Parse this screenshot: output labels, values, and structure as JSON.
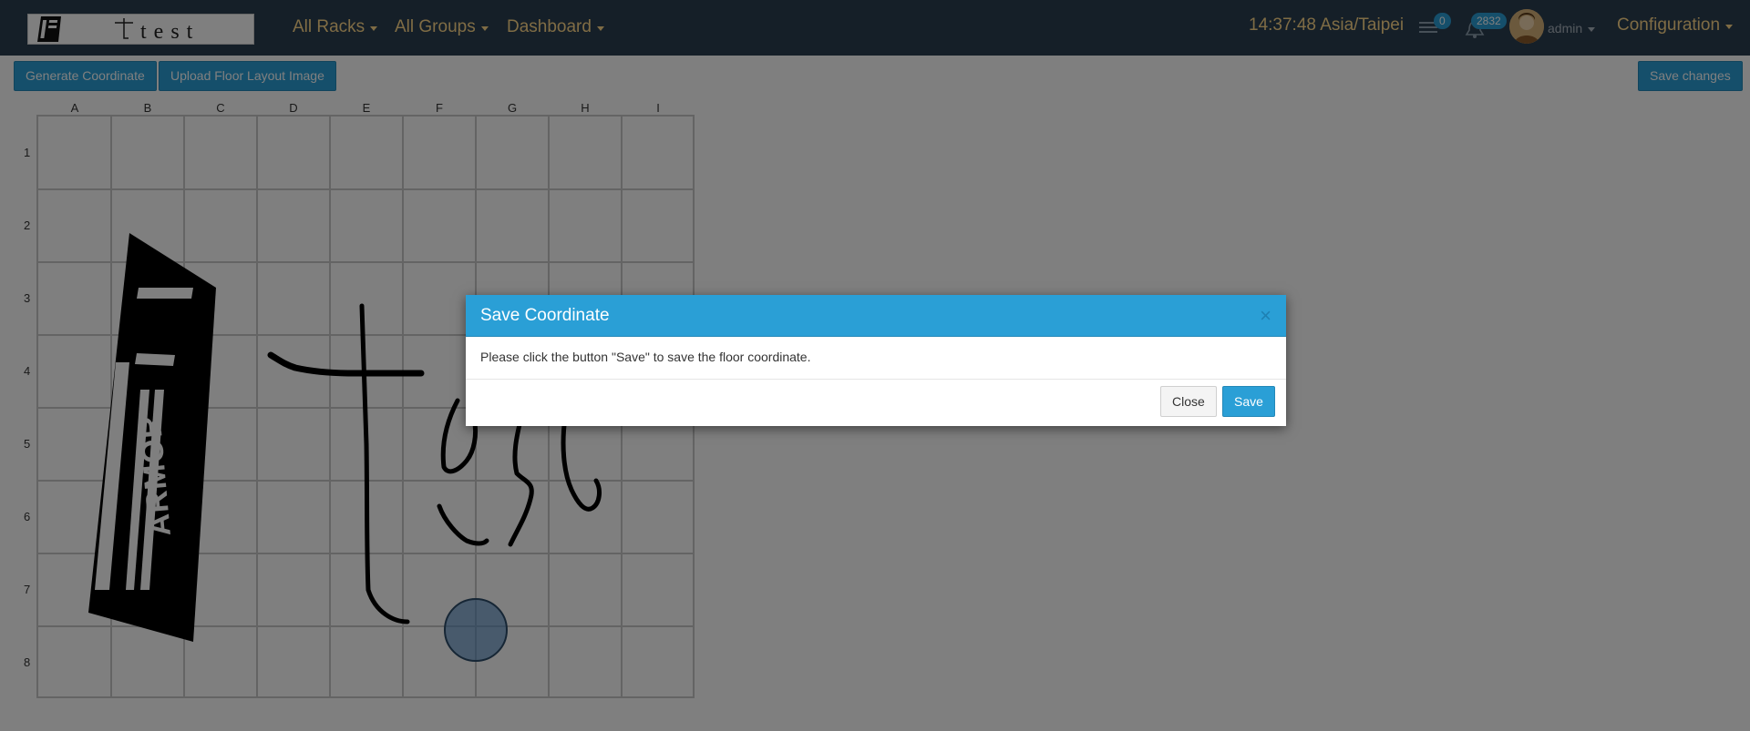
{
  "navbar": {
    "brand_text": "test",
    "menus": [
      {
        "label": "All Racks"
      },
      {
        "label": "All Groups"
      },
      {
        "label": "Dashboard"
      }
    ],
    "clock": "14:37:48 Asia/Taipei",
    "messages_badge": "0",
    "alerts_badge": "2832",
    "user_label": "admin",
    "config_label": "Configuration"
  },
  "toolbar": {
    "generate_label": "Generate Coordinate",
    "upload_label": "Upload Floor Layout Image",
    "save_changes_label": "Save changes"
  },
  "grid": {
    "columns": [
      "A",
      "B",
      "C",
      "D",
      "E",
      "F",
      "G",
      "H",
      "I"
    ],
    "rows": [
      "1",
      "2",
      "3",
      "4",
      "5",
      "6",
      "7",
      "8"
    ]
  },
  "modal": {
    "title": "Save Coordinate",
    "close_symbol": "×",
    "body": "Please click the button \"Save\" to save the floor coordinate.",
    "close_label": "Close",
    "save_label": "Save"
  },
  "colors": {
    "navbar": "#2b3e50",
    "accent": "#2a9fd6",
    "nav_text": "#ffd98a"
  },
  "icons": [
    "list-icon",
    "bell-icon",
    "caret-down-icon",
    "close-icon"
  ]
}
